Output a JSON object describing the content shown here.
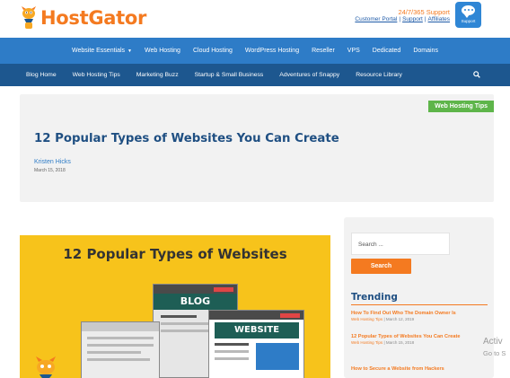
{
  "brand": {
    "name": "HostGator",
    "accent": "#f47a20"
  },
  "header": {
    "support_title": "24/7/365 Support",
    "links": [
      "Customer Portal",
      "Support",
      "Affiliates"
    ],
    "support_badge": "Support"
  },
  "nav_main": {
    "items": [
      "Website Essentials",
      "Web Hosting",
      "Cloud Hosting",
      "WordPress Hosting",
      "Reseller",
      "VPS",
      "Dedicated",
      "Domains"
    ]
  },
  "nav_blog": {
    "items": [
      "Blog Home",
      "Web Hosting Tips",
      "Marketing Buzz",
      "Startup & Small Business",
      "Adventures of Snappy",
      "Resource Library"
    ]
  },
  "post": {
    "category": "Web Hosting Tips",
    "title": "12 Popular Types of Websites You Can Create",
    "author": "Kristen Hicks",
    "date": "March 15, 2018"
  },
  "featured_image": {
    "title": "12 Popular Types of Websites",
    "blog_label": "BLOG",
    "website_label": "WEBSITE"
  },
  "sidebar": {
    "search_placeholder": "Search ...",
    "search_button": "Search",
    "trending_heading": "Trending",
    "trending": [
      {
        "title": "How To Find Out Who The Domain Owner Is",
        "category": "Web Hosting Tips",
        "date": "March 12, 2019"
      },
      {
        "title": "12 Popular Types of Websites You Can Create",
        "category": "Web Hosting Tips",
        "date": "March 15, 2018"
      },
      {
        "title": "How to Secure a Website from Hackers",
        "category": "",
        "date": ""
      }
    ]
  },
  "watermark": {
    "line1": "Activ",
    "line2": "Go to S"
  }
}
